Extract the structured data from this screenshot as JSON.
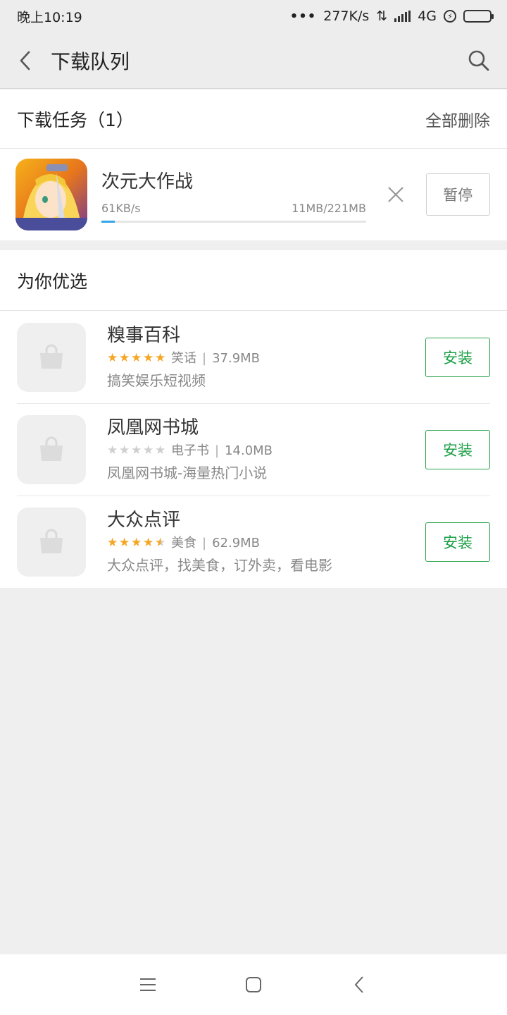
{
  "status_bar": {
    "time": "晚上10:19",
    "dots": "•••",
    "net_speed": "277K/s",
    "data_arrows": "⇅",
    "network": "4G",
    "battery_color": "#3bc43b"
  },
  "header": {
    "title": "下载队列",
    "back_icon": "chevron-left-icon",
    "search_icon": "search-icon"
  },
  "download_tasks": {
    "heading": "下载任务（1）",
    "delete_all": "全部删除",
    "items": [
      {
        "name": "次元大作战",
        "speed": "61KB/s",
        "size": "11MB/221MB",
        "progress_fraction": 0.05,
        "pause_label": "暂停"
      }
    ]
  },
  "recommended": {
    "heading": "为你优选",
    "apps": [
      {
        "name": "糗事百科",
        "rating": 5,
        "category": "笑话",
        "size": "37.9MB",
        "desc": "搞笑娱乐短视频",
        "install_label": "安装"
      },
      {
        "name": "凤凰网书城",
        "rating": 0,
        "category": "电子书",
        "size": "14.0MB",
        "desc": "凤凰网书城-海量热门小说",
        "install_label": "安装"
      },
      {
        "name": "大众点评",
        "rating": 4.5,
        "category": "美食",
        "size": "62.9MB",
        "desc": "大众点评，找美食，订外卖，看电影",
        "install_label": "安装"
      }
    ]
  },
  "colors": {
    "accent_green": "#1a9f45",
    "progress_blue": "#34a5ea",
    "star_orange": "#f5a623"
  }
}
